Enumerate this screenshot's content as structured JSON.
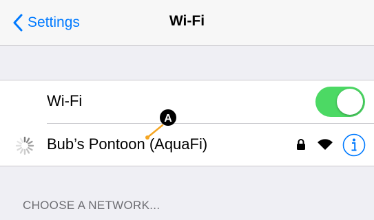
{
  "navbar": {
    "back_label": "Settings",
    "title": "Wi-Fi",
    "back_icon": "chevron-left-icon",
    "accent_color": "#007aff"
  },
  "wifi_toggle": {
    "label": "Wi-Fi",
    "state": "on",
    "on_color": "#4cd964"
  },
  "current_network": {
    "name": "Bub’s Pontoon (AquaFi)",
    "status": "connecting",
    "icons": [
      "spinner-icon",
      "lock-icon",
      "wifi-signal-icon",
      "info-icon"
    ]
  },
  "section_header": "CHOOSE A NETWORK...",
  "annotation": {
    "marker_label": "A",
    "color": "#f5a623"
  }
}
